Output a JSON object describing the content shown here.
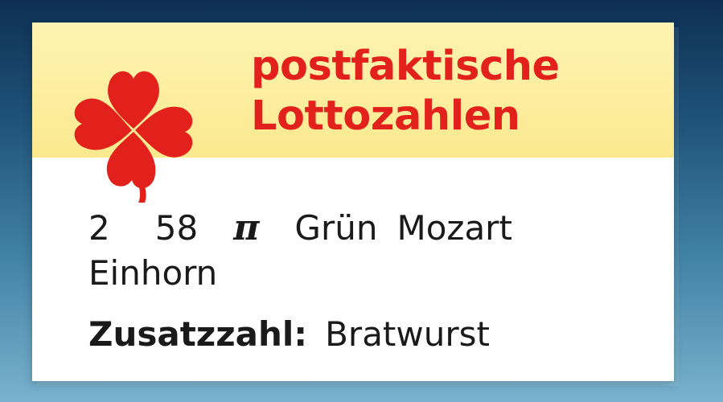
{
  "title": {
    "line1": "postfaktische",
    "line2": "Lottozahlen"
  },
  "numbers": [
    "2",
    "58",
    "π",
    "Grün",
    "Mozart",
    "Einhorn"
  ],
  "extra": {
    "label": "Zusatzzahl:",
    "value": "Bratwurst"
  },
  "colors": {
    "accent": "#e3211c",
    "banner": "#fce98f",
    "background_top": "#0e2f55",
    "background_bottom": "#78b2cf"
  },
  "icons": {
    "logo": "four-leaf-clover-icon"
  }
}
